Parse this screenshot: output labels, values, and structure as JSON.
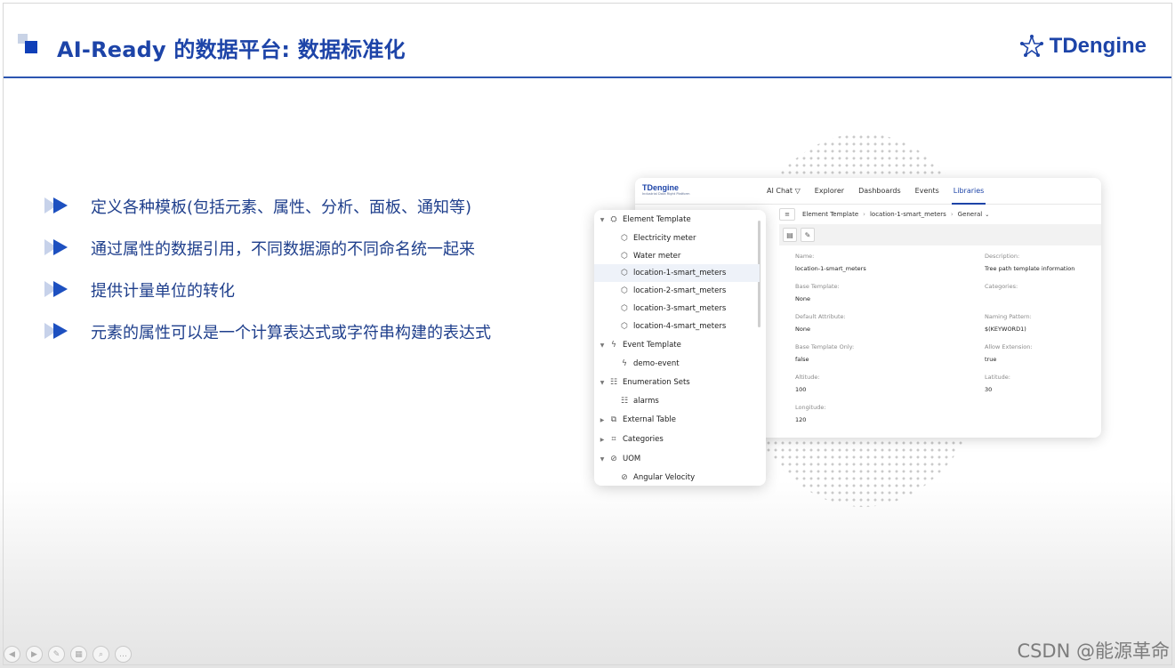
{
  "header": {
    "title": "AI-Ready 的数据平台: 数据标准化",
    "brand": "TDengine",
    "colors": {
      "accent": "#1d44a8",
      "rule": "#2c55b0"
    }
  },
  "bullets": [
    "定义各种模板(包括元素、属性、分析、面板、通知等)",
    "通过属性的数据引用，不同数据源的不同命名统一起来",
    "提供计量单位的转化",
    "元素的属性可以是一个计算表达式或字符串构建的表达式"
  ],
  "app": {
    "logo": "TDengine",
    "logo_sub": "Industrial Data Right Platform",
    "nav": [
      "AI Chat",
      "Explorer",
      "Dashboards",
      "Events",
      "Libraries"
    ],
    "nav_active": "Libraries",
    "breadcrumb": [
      "Element Template",
      "location-1-smart_meters",
      "General"
    ],
    "fields": {
      "name": {
        "label": "Name:",
        "value": "location-1-smart_meters"
      },
      "description": {
        "label": "Description:",
        "value": "Tree path template information"
      },
      "base_template": {
        "label": "Base Template:",
        "value": "None"
      },
      "categories": {
        "label": "Categories:",
        "value": ""
      },
      "default_attribute": {
        "label": "Default Attribute:",
        "value": "None"
      },
      "naming_pattern": {
        "label": "Naming Pattern:",
        "value": "$(KEYWORD1)"
      },
      "base_template_only": {
        "label": "Base Template Only:",
        "value": "false"
      },
      "allow_extension": {
        "label": "Allow Extension:",
        "value": "true"
      },
      "altitude": {
        "label": "Altitude:",
        "value": "100"
      },
      "latitude": {
        "label": "Latitude:",
        "value": "30"
      },
      "longitude": {
        "label": "Longitude:",
        "value": "120"
      }
    }
  },
  "tree": {
    "element_template": "Element Template",
    "element_items": [
      "Electricity meter",
      "Water meter",
      "location-1-smart_meters",
      "location-2-smart_meters",
      "location-3-smart_meters",
      "location-4-smart_meters"
    ],
    "event_template": "Event Template",
    "event_items": [
      "demo-event"
    ],
    "enumeration_sets": "Enumeration Sets",
    "enum_items": [
      "alarms"
    ],
    "external_table": "External Table",
    "categories": "Categories",
    "uom": "UOM",
    "uom_items": [
      "Angular Velocity"
    ]
  },
  "watermark": "CSDN @能源革命"
}
